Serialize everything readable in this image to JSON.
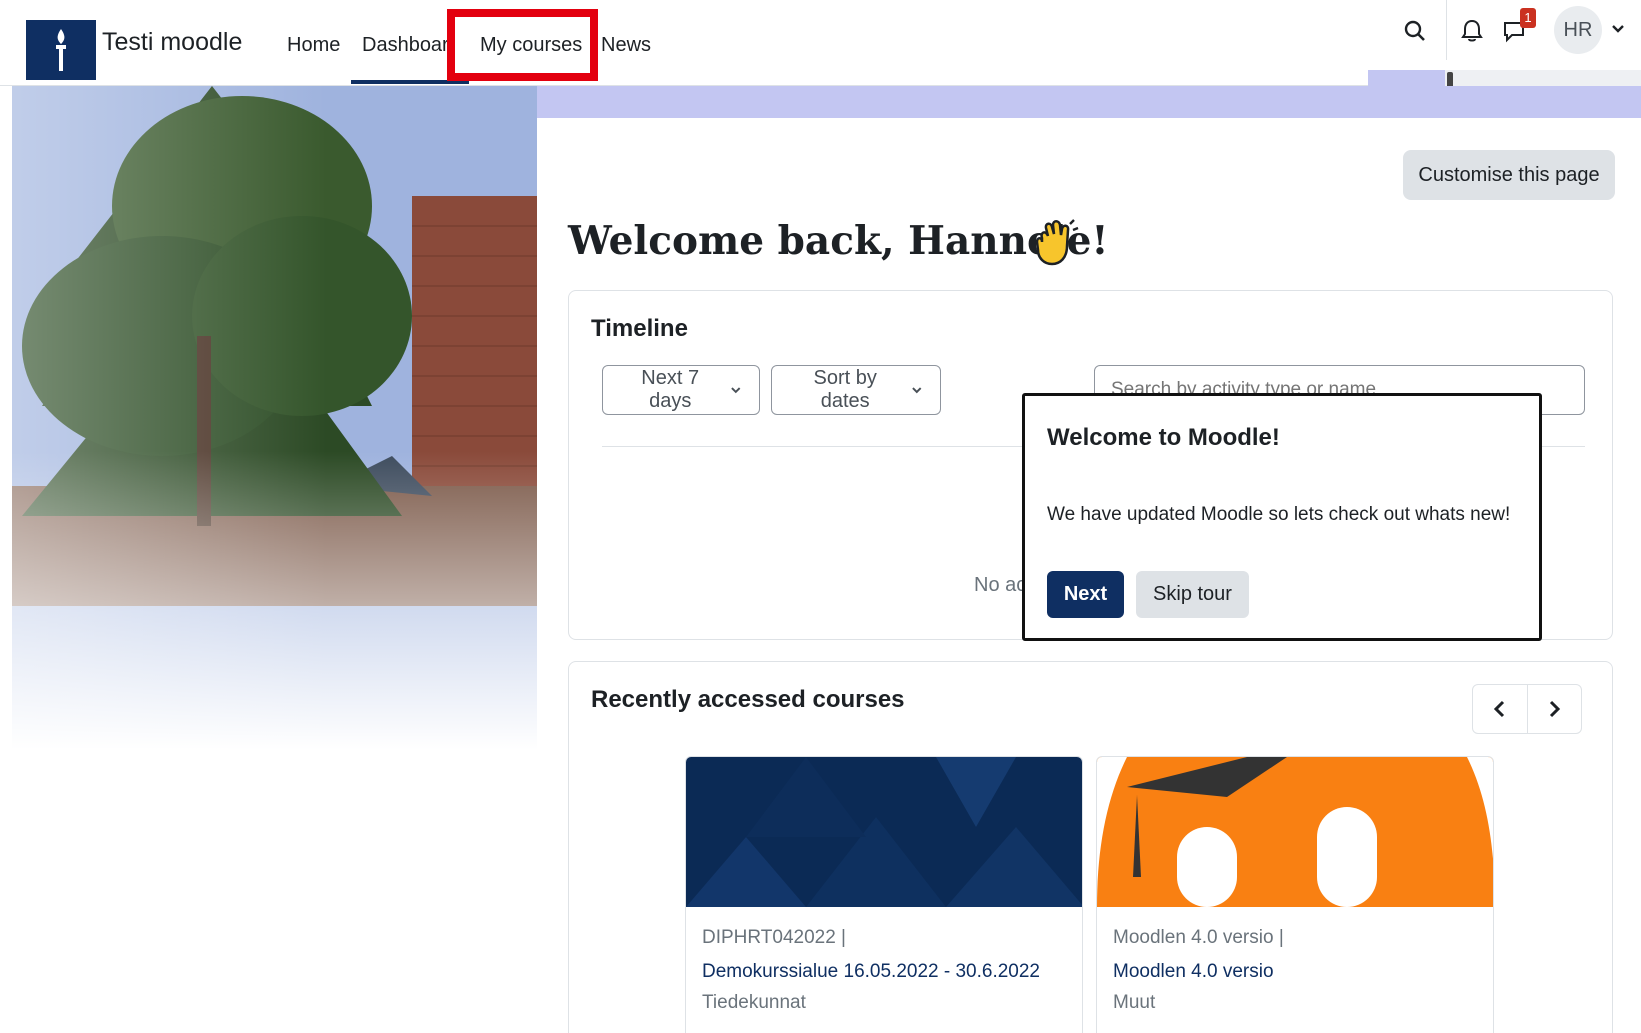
{
  "header": {
    "site_name": "Testi moodle",
    "nav": {
      "home": "Home",
      "dashboard": "Dashboard",
      "my_courses": "My courses",
      "news": "News"
    },
    "notification_count": "1",
    "user_initials": "HR"
  },
  "page": {
    "customise_label": "Customise this page",
    "welcome": "Welcome back, Hannele!"
  },
  "timeline": {
    "title": "Timeline",
    "filter_days": "Next 7 days",
    "sort": "Sort by dates",
    "search_placeholder": "Search by activity type or name",
    "empty_text": "No activities require action"
  },
  "tour": {
    "title": "Welcome to Moodle!",
    "text": "We have updated Moodle so lets check out whats new!",
    "next_label": "Next",
    "skip_label": "Skip tour"
  },
  "recent": {
    "title": "Recently accessed courses",
    "courses": [
      {
        "category": "DIPHRT042022 |",
        "name": "Demokurssialue 16.05.2022 - 30.6.2022",
        "sub": "Tiedekunnat"
      },
      {
        "category": "Moodlen 4.0 versio |",
        "name": "Moodlen 4.0 versio",
        "sub": "Muut"
      }
    ]
  },
  "colors": {
    "brand": "#0f2f62",
    "highlight": "#e3000f",
    "moodle_orange": "#f98012",
    "band": "#c3c6f2"
  }
}
